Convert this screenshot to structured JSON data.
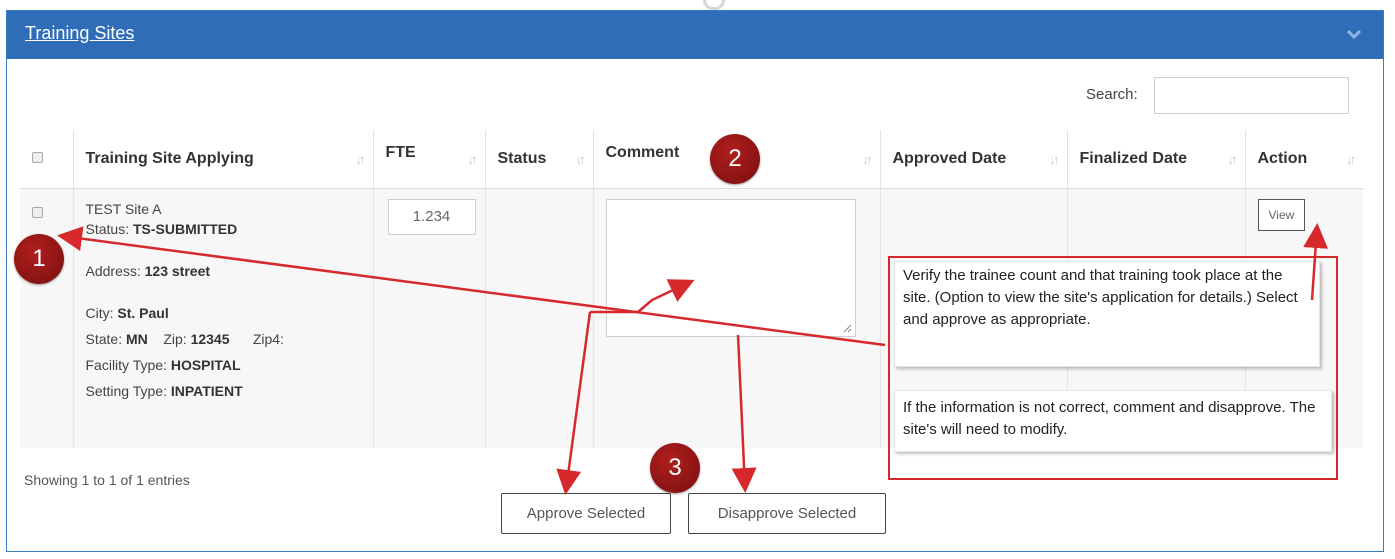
{
  "panel": {
    "title": "Training Sites"
  },
  "search": {
    "label": "Search:",
    "value": ""
  },
  "table": {
    "headers": [
      "Training Site Applying",
      "FTE",
      "Status",
      "Comment",
      "Approved Date",
      "Finalized Date",
      "Action"
    ],
    "row": {
      "site_name": "TEST Site A",
      "status_label": "Status:",
      "status_value": "TS-SUBMITTED",
      "address_label": "Address:",
      "address_value": "123 street",
      "city_label": "City:",
      "city_value": "St. Paul",
      "state_label": "State:",
      "state_value": "MN",
      "zip_label": "Zip:",
      "zip_value": "12345",
      "zip4_label": "Zip4:",
      "facility_label": "Facility Type:",
      "facility_value": "HOSPITAL",
      "setting_label": "Setting Type:",
      "setting_value": "INPATIENT",
      "fte_value": "1.234",
      "status_cell": "",
      "comment_value": "",
      "approved_date": "",
      "finalized_date": "",
      "action_label": "View"
    }
  },
  "footer": {
    "showing": "Showing 1 to 1 of 1 entries",
    "approve_label": "Approve Selected",
    "disapprove_label": "Disapprove Selected"
  },
  "annotations": {
    "badges": [
      "1",
      "2",
      "3"
    ],
    "callout_text_1": "Verify the trainee count and that training took place at the site. (Option to view the site's application for details.) Select and approve as appropriate.",
    "callout_text_2": "If the information is not correct, comment and disapprove. The site's will need to modify.",
    "accent_color": "#d7282b",
    "badge_color": "#8b1212",
    "header_color": "#2f6db8"
  }
}
